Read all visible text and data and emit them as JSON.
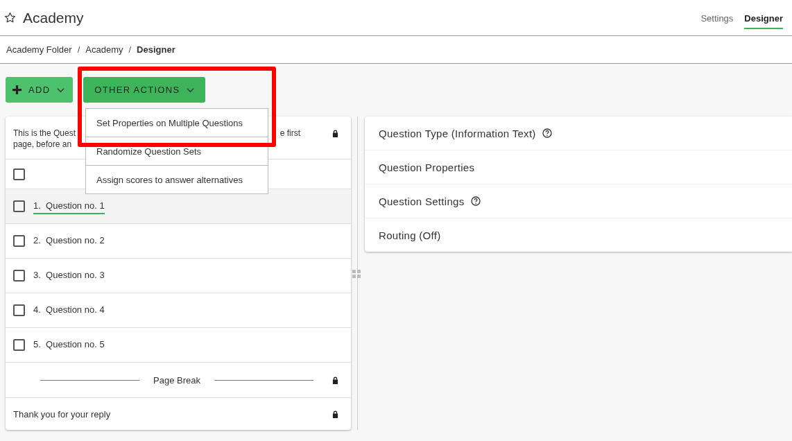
{
  "header": {
    "title": "Academy",
    "favorite": false,
    "tabs": [
      {
        "label": "Settings",
        "selected": false
      },
      {
        "label": "Designer",
        "selected": true
      }
    ]
  },
  "breadcrumb": [
    {
      "label": "Academy Folder",
      "current": false
    },
    {
      "separator": "/",
      "label": "Academy",
      "current": false
    },
    {
      "separator": "/",
      "label": "Designer",
      "current": true
    }
  ],
  "toolbar": {
    "add_button": "ADD",
    "other_actions_button": "OTHER ACTIONS"
  },
  "dropdown": {
    "items": [
      "Set Properties on Multiple Questions",
      "Randomize Question Sets",
      "Assign scores to answer alternatives"
    ]
  },
  "question_list": {
    "intro_fragments": [
      "This is the Quest",
      "e first",
      "page, before an"
    ],
    "intro_locked": true,
    "select_all_checked": false,
    "questions": [
      {
        "number": "1.",
        "label": "Question no. 1",
        "selected": true,
        "checked": false
      },
      {
        "number": "2.",
        "label": "Question no. 2",
        "selected": false,
        "checked": false
      },
      {
        "number": "3.",
        "label": "Question no. 3",
        "selected": false,
        "checked": false
      },
      {
        "number": "4.",
        "label": "Question no. 4",
        "selected": false,
        "checked": false
      },
      {
        "number": "5.",
        "label": "Question no. 5",
        "selected": false,
        "checked": false
      }
    ],
    "page_break": {
      "label": "Page Break",
      "locked": true
    },
    "end_text": {
      "label": "Thank you for your reply",
      "locked": true
    }
  },
  "properties_panel": [
    {
      "label": "Question Type (Information Text)",
      "help": true
    },
    {
      "label": "Question Properties",
      "help": false
    },
    {
      "label": "Question Settings",
      "help": true
    },
    {
      "label": "Routing (Off)",
      "help": false
    }
  ]
}
